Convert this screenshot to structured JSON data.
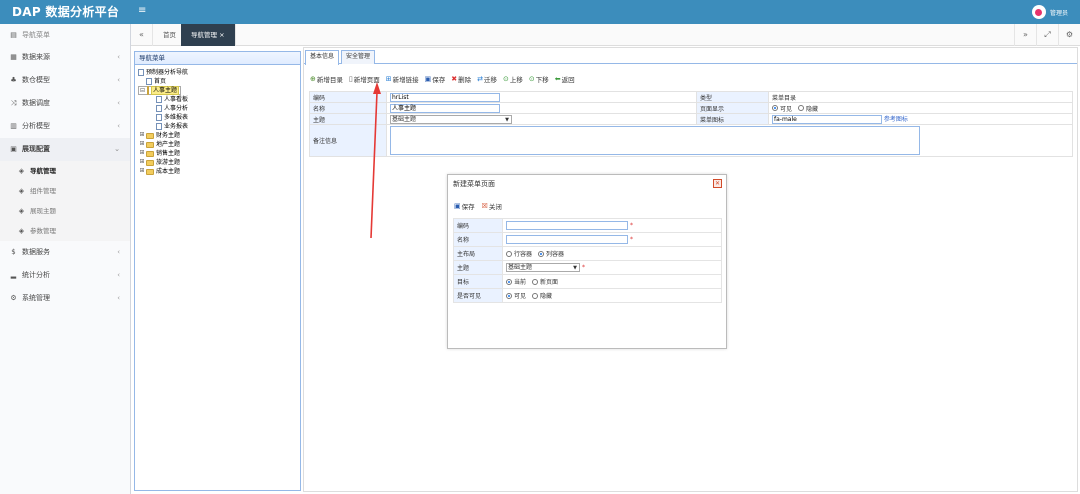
{
  "topbar": {
    "logo": "DAP 数据分析平台",
    "menu_icon": "≡",
    "user_name": "管理员"
  },
  "sidebar": {
    "header": "导航菜单",
    "items": [
      {
        "label": "数据来源"
      },
      {
        "label": "数仓模型"
      },
      {
        "label": "数据调度"
      },
      {
        "label": "分析模型"
      },
      {
        "label": "展现配置"
      },
      {
        "label": "数据服务"
      },
      {
        "label": "统计分析"
      },
      {
        "label": "系统管理"
      }
    ],
    "sub_items": [
      {
        "label": "导航管理"
      },
      {
        "label": "组件管理"
      },
      {
        "label": "展现主题"
      },
      {
        "label": "参数管理"
      }
    ]
  },
  "tabs": {
    "items": [
      {
        "label": "首页"
      },
      {
        "label": "导航管理 ×"
      }
    ]
  },
  "tree": {
    "header": "导航菜单",
    "root": "预制器分析导航",
    "home": "首页",
    "hr": "人事主题",
    "hr_children": [
      "人事看板",
      "人事分析",
      "多维报表",
      "业务报表"
    ],
    "others": [
      "财务主题",
      "地产主题",
      "销售主题",
      "旅游主题",
      "成本主题"
    ]
  },
  "detail": {
    "tabs": [
      "基本信息",
      "安全管理"
    ],
    "toolbar": [
      "新增目录",
      "新增页面",
      "新增链接",
      "保存",
      "删除",
      "迁移",
      "上移",
      "下移",
      "返回"
    ],
    "form": {
      "code_label": "编码",
      "code_value": "hrList",
      "type_label": "类型",
      "type_value": "菜单目录",
      "name_label": "名称",
      "name_value": "人事主题",
      "display_label": "页面显示",
      "visible": "可见",
      "hidden": "隐藏",
      "theme_label": "主题",
      "theme_value": "基础主题",
      "icon_label": "菜单图标",
      "icon_value": "fa-male",
      "icon_ref": "参考图标",
      "remark_label": "备注信息"
    }
  },
  "dialog": {
    "title": "新建菜单页面",
    "save": "保存",
    "close": "关闭",
    "code_label": "编码",
    "name_label": "名称",
    "layout_label": "主布局",
    "layout_row": "行容器",
    "layout_col": "列容器",
    "theme_label": "主题",
    "theme_value": "基础主题",
    "target_label": "目标",
    "target_current": "当前",
    "target_new": "新页面",
    "visible_label": "是否可见",
    "visible": "可见",
    "hidden": "隐藏",
    "required_mark": "*"
  },
  "colors": {
    "primary": "#3c8dbc",
    "annotation": "#e53935"
  }
}
